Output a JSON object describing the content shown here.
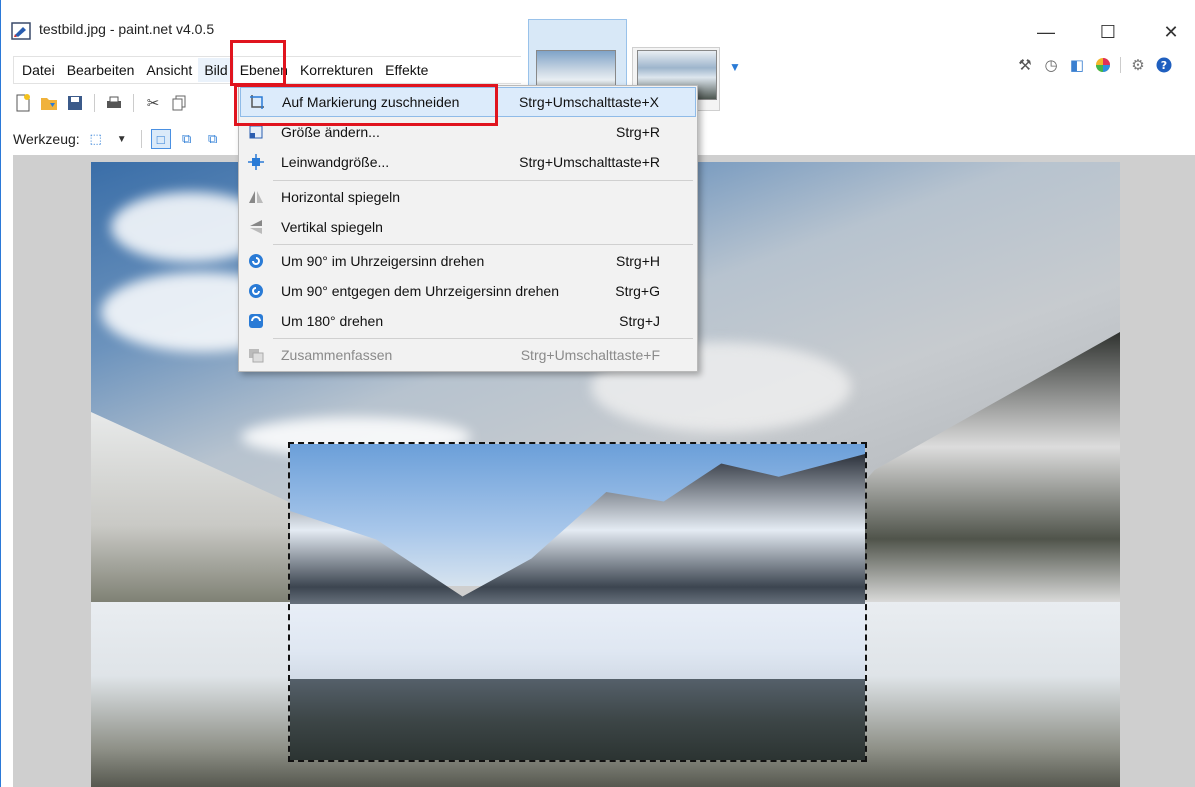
{
  "window": {
    "title": "testbild.jpg - paint.net v4.0.5",
    "min_glyph": "—",
    "max_glyph": "☐",
    "close_glyph": "✕"
  },
  "menubar": {
    "items": [
      "Datei",
      "Bearbeiten",
      "Ansicht",
      "Bild",
      "Ebenen",
      "Korrekturen",
      "Effekte"
    ]
  },
  "options": {
    "tool_label": "Werkzeug:"
  },
  "image_menu": {
    "items": [
      {
        "label": "Auf Markierung zuschneiden",
        "shortcut": "Strg+Umschalttaste+X",
        "icon": "crop-icon"
      },
      {
        "label": "Größe ändern...",
        "shortcut": "Strg+R",
        "icon": "resize-icon"
      },
      {
        "label": "Leinwandgröße...",
        "shortcut": "Strg+Umschalttaste+R",
        "icon": "canvas-size-icon"
      },
      {
        "label": "Horizontal spiegeln",
        "shortcut": "",
        "icon": "flip-horizontal-icon"
      },
      {
        "label": "Vertikal spiegeln",
        "shortcut": "",
        "icon": "flip-vertical-icon"
      },
      {
        "label": "Um 90° im Uhrzeigersinn drehen",
        "shortcut": "Strg+H",
        "icon": "rotate-cw-icon"
      },
      {
        "label": "Um 90° entgegen dem Uhrzeigersinn drehen",
        "shortcut": "Strg+G",
        "icon": "rotate-ccw-icon"
      },
      {
        "label": "Um 180° drehen",
        "shortcut": "Strg+J",
        "icon": "rotate-180-icon"
      },
      {
        "label": "Zusammenfassen",
        "shortcut": "Strg+Umschalttaste+F",
        "icon": "flatten-icon"
      }
    ]
  },
  "colors": {
    "highlight_red": "#e0141e",
    "accent_blue": "#2a7bd6",
    "menu_hover": "#dcebfb"
  }
}
